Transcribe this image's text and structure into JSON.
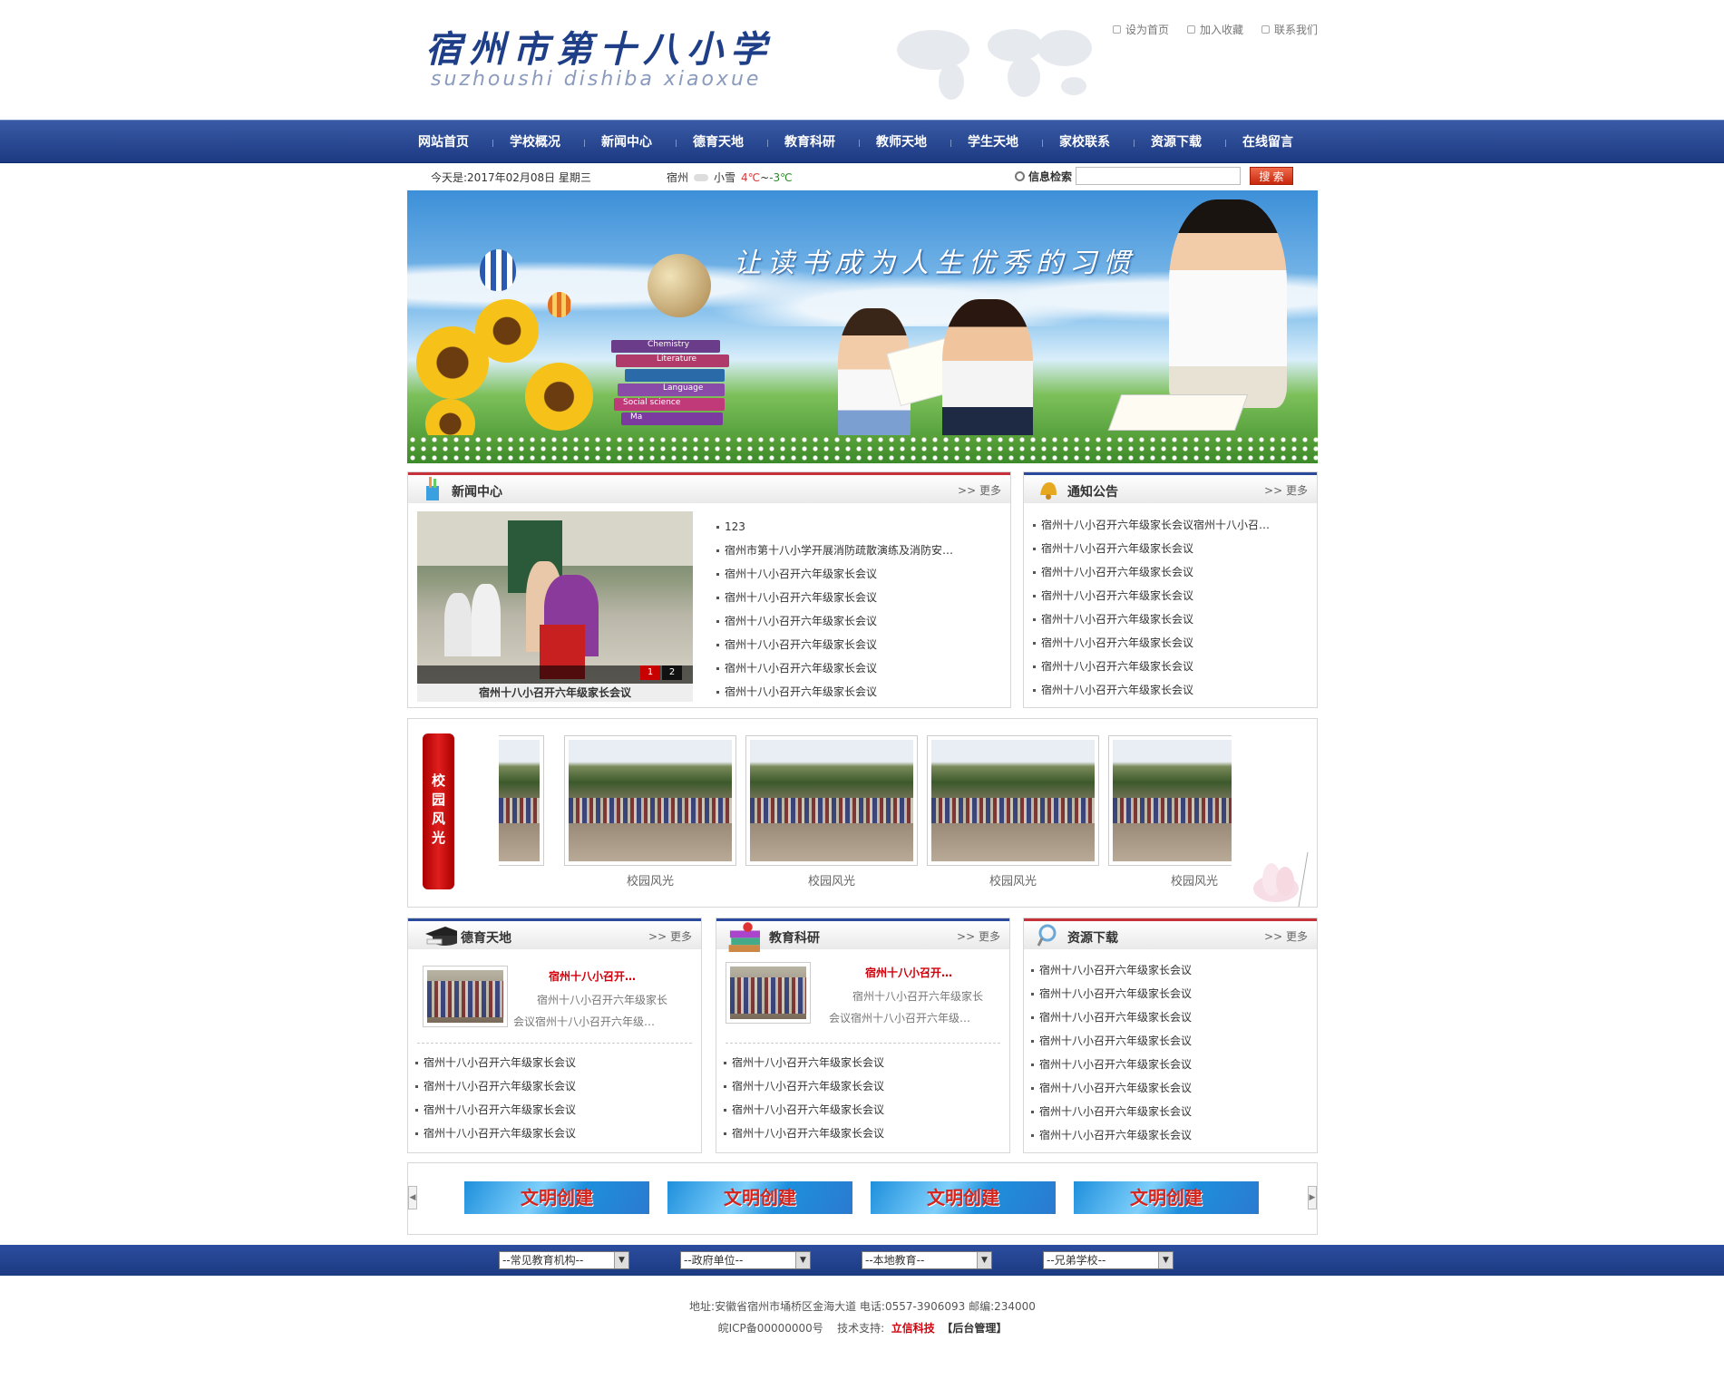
{
  "header": {
    "logo_cn": "宿州市第十八小学",
    "logo_en": "suzhoushi dishiba xiaoxue",
    "links": [
      "设为首页",
      "加入收藏",
      "联系我们"
    ]
  },
  "nav": [
    "网站首页",
    "学校概况",
    "新闻中心",
    "德育天地",
    "教育科研",
    "教师天地",
    "学生天地",
    "家校联系",
    "资源下载",
    "在线留言"
  ],
  "info": {
    "date": "今天是:2017年02月08日  星期三",
    "city": "宿州",
    "weather": "小雪",
    "temp_high": "4℃",
    "temp_sep": "~",
    "temp_low": "-3℃",
    "search_label": "信息检索",
    "search_value": "",
    "search_button": "搜 索"
  },
  "banner": {
    "slogan": "让读书成为人生优秀的习惯",
    "book_labels": [
      "Chemistry",
      "Literature",
      "Language",
      "Social science",
      "Ma"
    ]
  },
  "news": {
    "title": "新闻中心",
    "more": "更多",
    "caption": "宿州十八小召开六年级家长会议",
    "pager": [
      "1",
      "2"
    ],
    "items": [
      "123",
      "宿州市第十八小学开展消防疏散演练及消防安…",
      "宿州十八小召开六年级家长会议",
      "宿州十八小召开六年级家长会议",
      "宿州十八小召开六年级家长会议",
      "宿州十八小召开六年级家长会议",
      "宿州十八小召开六年级家长会议",
      "宿州十八小召开六年级家长会议"
    ]
  },
  "notice": {
    "title": "通知公告",
    "more": "更多",
    "items": [
      "宿州十八小召开六年级家长会议宿州十八小召…",
      "宿州十八小召开六年级家长会议",
      "宿州十八小召开六年级家长会议",
      "宿州十八小召开六年级家长会议",
      "宿州十八小召开六年级家长会议",
      "宿州十八小召开六年级家长会议",
      "宿州十八小召开六年级家长会议",
      "宿州十八小召开六年级家长会议"
    ]
  },
  "campus": {
    "title": "校园风光",
    "captions": [
      "校园风光",
      "校园风光",
      "校园风光",
      "校园风光"
    ]
  },
  "moral": {
    "title": "德育天地",
    "more": "更多",
    "feature_title": "宿州十八小召开…",
    "feature_text_1": "宿州十八小召开六年级家长",
    "feature_text_2": "会议宿州十八小召开六年级…",
    "items": [
      "宿州十八小召开六年级家长会议",
      "宿州十八小召开六年级家长会议",
      "宿州十八小召开六年级家长会议",
      "宿州十八小召开六年级家长会议"
    ]
  },
  "research": {
    "title": "教育科研",
    "more": "更多",
    "feature_title": "宿州十八小召开…",
    "feature_text_1": "宿州十八小召开六年级家长",
    "feature_text_2": "会议宿州十八小召开六年级…",
    "items": [
      "宿州十八小召开六年级家长会议",
      "宿州十八小召开六年级家长会议",
      "宿州十八小召开六年级家长会议",
      "宿州十八小召开六年级家长会议"
    ]
  },
  "download": {
    "title": "资源下载",
    "more": "更多",
    "items": [
      "宿州十八小召开六年级家长会议",
      "宿州十八小召开六年级家长会议",
      "宿州十八小召开六年级家长会议",
      "宿州十八小召开六年级家长会议",
      "宿州十八小召开六年级家长会议",
      "宿州十八小召开六年级家长会议",
      "宿州十八小召开六年级家长会议",
      "宿州十八小召开六年级家长会议"
    ]
  },
  "banners": [
    "文明创建",
    "文明创建",
    "文明创建",
    "文明创建"
  ],
  "selects": [
    "--常见教育机构--",
    "--政府单位--",
    "--本地教育--",
    "--兄弟学校--"
  ],
  "footer": {
    "line1": "地址:安徽省宿州市埇桥区金海大道  电话:0557-3906093  邮编:234000",
    "icp": "皖ICP备00000000号",
    "support_label": "技术支持:",
    "support_name": "立信科技",
    "admin": "【后台管理】"
  },
  "colors": {
    "nav": "#2b4a9c",
    "accent_red": "#c6313a"
  }
}
